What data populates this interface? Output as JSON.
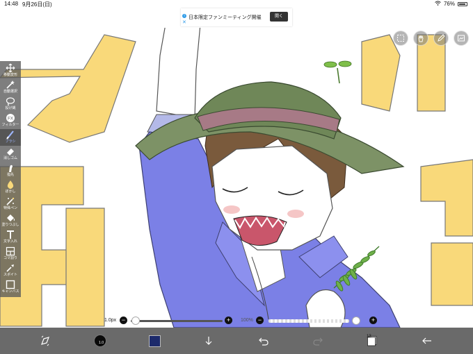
{
  "status_bar": {
    "time": "14:48",
    "date": "9月26日(日)",
    "battery": "76%"
  },
  "ad": {
    "text": "日本限定ファンミーティング開催",
    "button": "開く",
    "info_icon": "info-icon",
    "close_icon": "close-icon"
  },
  "toolbar": {
    "tools": [
      {
        "label": "移動変形",
        "icon": "move-icon"
      },
      {
        "label": "自動選択",
        "icon": "magic-wand-icon"
      },
      {
        "label": "投げ縄",
        "icon": "lasso-icon"
      },
      {
        "label": "フィルター",
        "icon": "filter-fx-icon"
      },
      {
        "label": "ブラシ",
        "icon": "brush-icon"
      },
      {
        "label": "消しゴム",
        "icon": "eraser-icon"
      },
      {
        "label": "指先",
        "icon": "smudge-icon"
      },
      {
        "label": "ぼかし",
        "icon": "blur-drop-icon"
      },
      {
        "label": "特殊ペン",
        "icon": "special-pen-icon"
      },
      {
        "label": "塗りつぶし",
        "icon": "fill-bucket-icon"
      },
      {
        "label": "文字入れ",
        "icon": "text-tool-icon"
      },
      {
        "label": "コマ割り",
        "icon": "frame-divider-icon"
      },
      {
        "label": "スポイト",
        "icon": "eyedropper-icon"
      },
      {
        "label": "キャンバス",
        "icon": "canvas-icon"
      }
    ],
    "active_tool": "ブラシ"
  },
  "top_tools": [
    "selection-icon",
    "hand-icon",
    "pen-pressure-icon",
    "export-icon"
  ],
  "sliders": {
    "brush_size": "1.0px",
    "size_level": 0.0,
    "opacity": "100%",
    "opacity_level": 1.0
  },
  "bottom_bar": {
    "brush_size_badge": "1.0",
    "layer_count": "13",
    "current_color": "#1c2a6b",
    "icons": [
      "transform-icon",
      "brush-preview",
      "color-swatch",
      "download-icon",
      "undo-icon",
      "redo-icon",
      "layers-icon",
      "back-icon"
    ]
  },
  "colors": {
    "toolbar_bg": "#5a5a5a",
    "bottom_bg": "#555555",
    "big_letter_fill": "#f9d97a",
    "jacket": "#7b80e6",
    "hat": "#7d9266",
    "hat_band": "#a77a86",
    "hair": "#7a5a3c"
  }
}
